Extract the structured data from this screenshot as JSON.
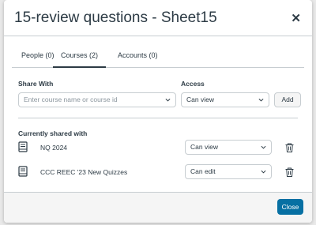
{
  "dialog": {
    "title": "15-review questions - Sheet15",
    "close_icon": "close-icon"
  },
  "tabs": [
    {
      "label": "People (0)",
      "active": false
    },
    {
      "label": "Courses (2)",
      "active": true
    },
    {
      "label": "Accounts (0)",
      "active": false
    }
  ],
  "share": {
    "share_with_label": "Share With",
    "course_placeholder": "Enter course name or course id",
    "access_label": "Access",
    "access_value": "Can view",
    "add_label": "Add"
  },
  "shared": {
    "heading": "Currently shared with",
    "rows": [
      {
        "name": "NQ 2024",
        "access": "Can view",
        "icon": "course-book-icon"
      },
      {
        "name": "CCC REEC '23 New Quizzes",
        "access": "Can edit",
        "icon": "course-book-icon"
      }
    ]
  },
  "footer": {
    "close_label": "Close"
  },
  "colors": {
    "primary": "#0770a3",
    "text": "#2d3b45",
    "border": "#c7cdd1"
  }
}
